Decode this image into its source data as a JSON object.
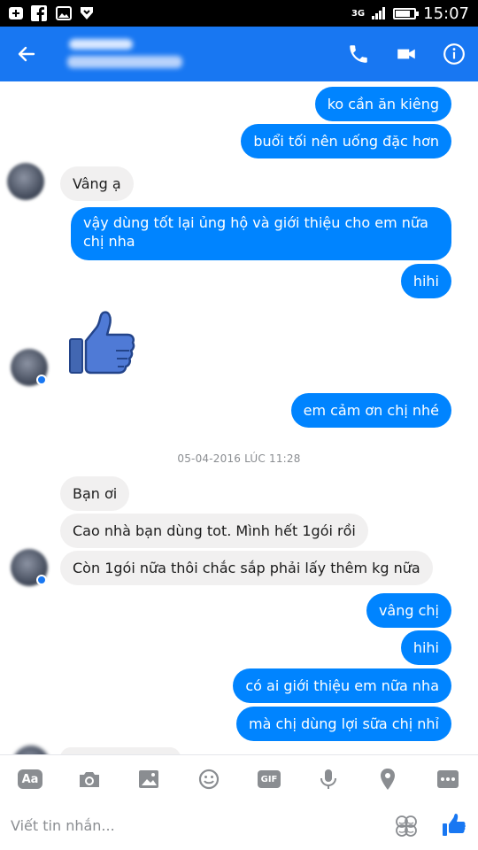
{
  "status_bar": {
    "network": "3G",
    "battery_level": 0.8,
    "time": "15:07",
    "left_icons": [
      "add-box-icon",
      "facebook-icon",
      "image-icon",
      "download-icon"
    ]
  },
  "header": {
    "back_icon": "arrow-left-icon",
    "actions": [
      "phone-icon",
      "video-camera-icon",
      "info-icon"
    ],
    "bg_color": "#1877f2"
  },
  "messages": [
    {
      "dir": "out",
      "text": "ko cần ăn kiêng"
    },
    {
      "dir": "out",
      "text": "buổi tối nên uống đặc hơn"
    },
    {
      "dir": "in",
      "text": "Vâng ạ"
    },
    {
      "dir": "out",
      "text_line1": "vậy dùng tốt lại ủng hộ và giới thiệu cho em nữa",
      "text_line2": "chị nha"
    },
    {
      "dir": "out",
      "text": "hihi"
    },
    {
      "dir": "in",
      "type": "like-sticker"
    },
    {
      "dir": "out",
      "text": "em cảm ơn chị nhé"
    },
    {
      "dir": "in",
      "text": "Bạn ơi"
    },
    {
      "dir": "in",
      "text": "Cao nhà bạn dùng tot. Mình hết 1gói rồi"
    },
    {
      "dir": "in",
      "text": "Còn 1gói nữa thôi chắc sắp phải lấy thêm kg nữa"
    },
    {
      "dir": "out",
      "text": "vâng chị"
    },
    {
      "dir": "out",
      "text": "hihi"
    },
    {
      "dir": "out",
      "text": "có ai giới thiệu em nữa nha"
    },
    {
      "dir": "out",
      "text": "mà chị dùng lợi sữa chị nhỉ"
    }
  ],
  "timestamp": "05-04-2016 LÚC 11:28",
  "composer": {
    "tools": [
      "text-style-icon",
      "camera-icon",
      "gallery-icon",
      "emoji-icon",
      "gif-icon",
      "microphone-icon",
      "location-icon",
      "more-icon"
    ],
    "aa_label": "Aa",
    "gif_label": "GIF",
    "placeholder": "Viết tin nhắn...",
    "right_icons": [
      "stickers-icon",
      "like-icon"
    ]
  },
  "colors": {
    "outgoing": "#0084ff",
    "incoming": "#f1f0f0",
    "accent": "#1877f2"
  }
}
